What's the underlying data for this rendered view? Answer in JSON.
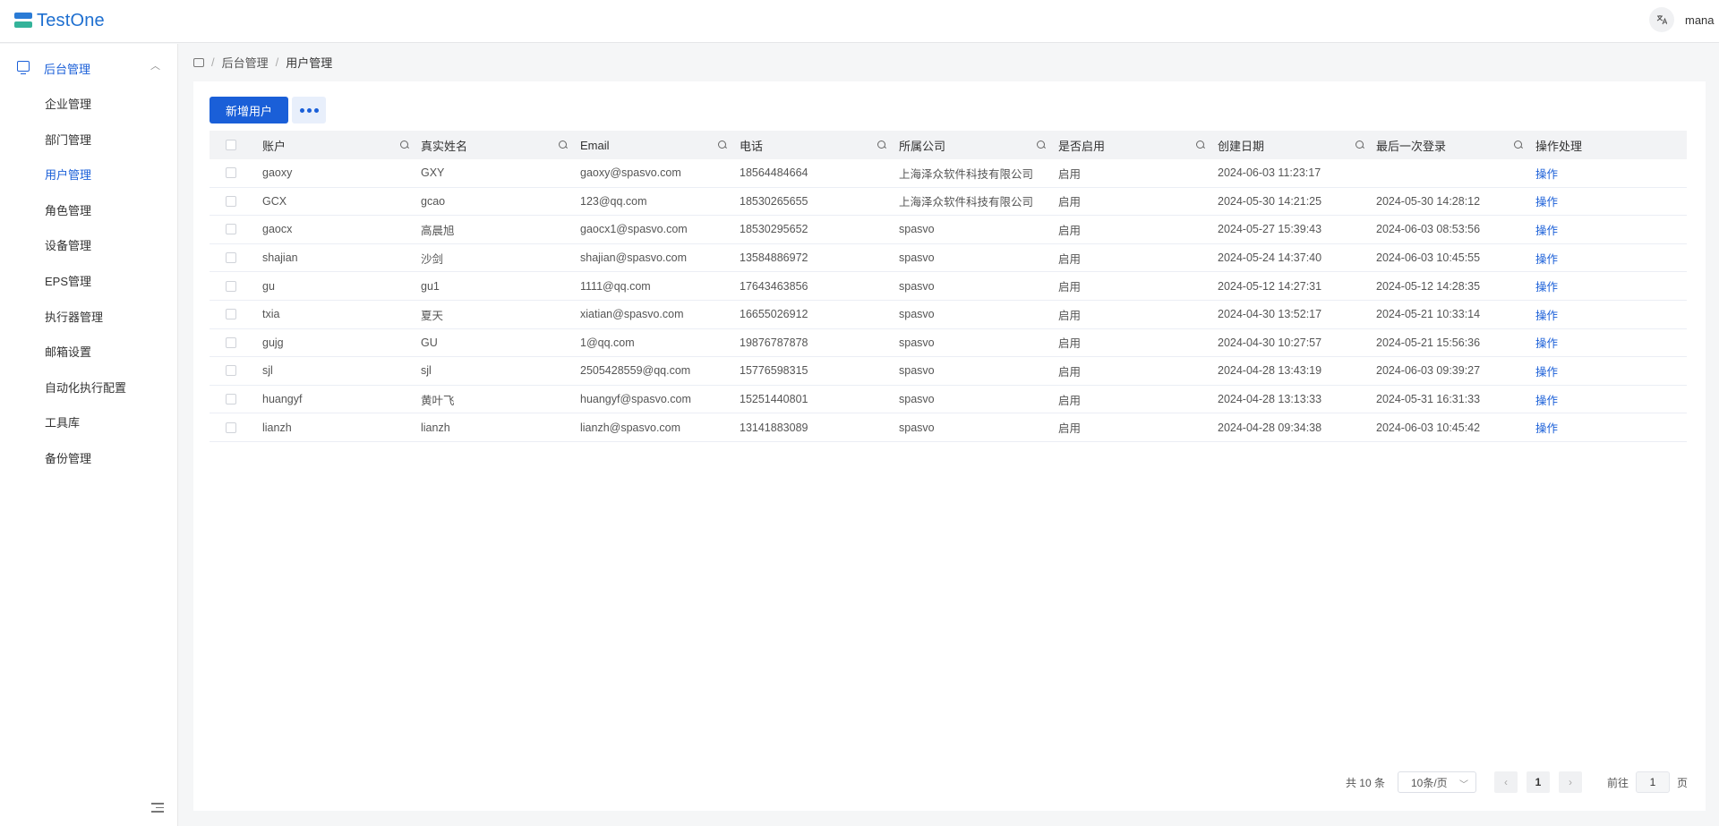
{
  "app": {
    "name": "TestOne",
    "user": "mana",
    "lang_icon": "translate-icon"
  },
  "colors": {
    "primary": "#1a5fd8",
    "logo_top": "#2a7bd6",
    "logo_bottom": "#34b39a"
  },
  "sidebar": {
    "group_label": "后台管理",
    "items": [
      {
        "label": "企业管理"
      },
      {
        "label": "部门管理"
      },
      {
        "label": "用户管理",
        "active": true
      },
      {
        "label": "角色管理"
      },
      {
        "label": "设备管理"
      },
      {
        "label": "EPS管理"
      },
      {
        "label": "执行器管理"
      },
      {
        "label": "邮箱设置"
      },
      {
        "label": "自动化执行配置"
      },
      {
        "label": "工具库"
      },
      {
        "label": "备份管理"
      }
    ]
  },
  "breadcrumb": {
    "parent": "后台管理",
    "current": "用户管理",
    "separator": "/"
  },
  "toolbar": {
    "add_label": "新增用户"
  },
  "table": {
    "columns": [
      "账户",
      "真实姓名",
      "Email",
      "电话",
      "所属公司",
      "是否启用",
      "创建日期",
      "最后一次登录",
      "操作处理"
    ],
    "rows": [
      {
        "account": "gaoxy",
        "name": "GXY",
        "email": "gaoxy@spasvo.com",
        "phone": "18564484664",
        "company": "上海泽众软件科技有限公司",
        "enabled": "启用",
        "created": "2024-06-03 11:23:17",
        "last_login": "",
        "action": "操作"
      },
      {
        "account": "GCX",
        "name": "gcao",
        "email": "123@qq.com",
        "phone": "18530265655",
        "company": "上海泽众软件科技有限公司",
        "enabled": "启用",
        "created": "2024-05-30 14:21:25",
        "last_login": "2024-05-30 14:28:12",
        "action": "操作"
      },
      {
        "account": "gaocx",
        "name": "高晨旭",
        "email": "gaocx1@spasvo.com",
        "phone": "18530295652",
        "company": "spasvo",
        "enabled": "启用",
        "created": "2024-05-27 15:39:43",
        "last_login": "2024-06-03 08:53:56",
        "action": "操作"
      },
      {
        "account": "shajian",
        "name": "沙剑",
        "email": "shajian@spasvo.com",
        "phone": "13584886972",
        "company": "spasvo",
        "enabled": "启用",
        "created": "2024-05-24 14:37:40",
        "last_login": "2024-06-03 10:45:55",
        "action": "操作"
      },
      {
        "account": "gu",
        "name": "gu1",
        "email": "1111@qq.com",
        "phone": "17643463856",
        "company": "spasvo",
        "enabled": "启用",
        "created": "2024-05-12 14:27:31",
        "last_login": "2024-05-12 14:28:35",
        "action": "操作"
      },
      {
        "account": "txia",
        "name": "夏天",
        "email": "xiatian@spasvo.com",
        "phone": "16655026912",
        "company": "spasvo",
        "enabled": "启用",
        "created": "2024-04-30 13:52:17",
        "last_login": "2024-05-21 10:33:14",
        "action": "操作"
      },
      {
        "account": "gujg",
        "name": "GU",
        "email": "1@qq.com",
        "phone": "19876787878",
        "company": "spasvo",
        "enabled": "启用",
        "created": "2024-04-30 10:27:57",
        "last_login": "2024-05-21 15:56:36",
        "action": "操作"
      },
      {
        "account": "sjl",
        "name": "sjl",
        "email": "2505428559@qq.com",
        "phone": "15776598315",
        "company": "spasvo",
        "enabled": "启用",
        "created": "2024-04-28 13:43:19",
        "last_login": "2024-06-03 09:39:27",
        "action": "操作"
      },
      {
        "account": "huangyf",
        "name": "黄叶飞",
        "email": "huangyf@spasvo.com",
        "phone": "15251440801",
        "company": "spasvo",
        "enabled": "启用",
        "created": "2024-04-28 13:13:33",
        "last_login": "2024-05-31 16:31:33",
        "action": "操作"
      },
      {
        "account": "lianzh",
        "name": "lianzh",
        "email": "lianzh@spasvo.com",
        "phone": "13141883089",
        "company": "spasvo",
        "enabled": "启用",
        "created": "2024-04-28 09:34:38",
        "last_login": "2024-06-03 10:45:42",
        "action": "操作"
      }
    ]
  },
  "pagination": {
    "total": "共 10 条",
    "page_size": "10条/页",
    "prev": "‹",
    "next": "›",
    "current_page": "1",
    "goto_label": "前往",
    "goto_value": "1",
    "goto_suffix": "页"
  }
}
